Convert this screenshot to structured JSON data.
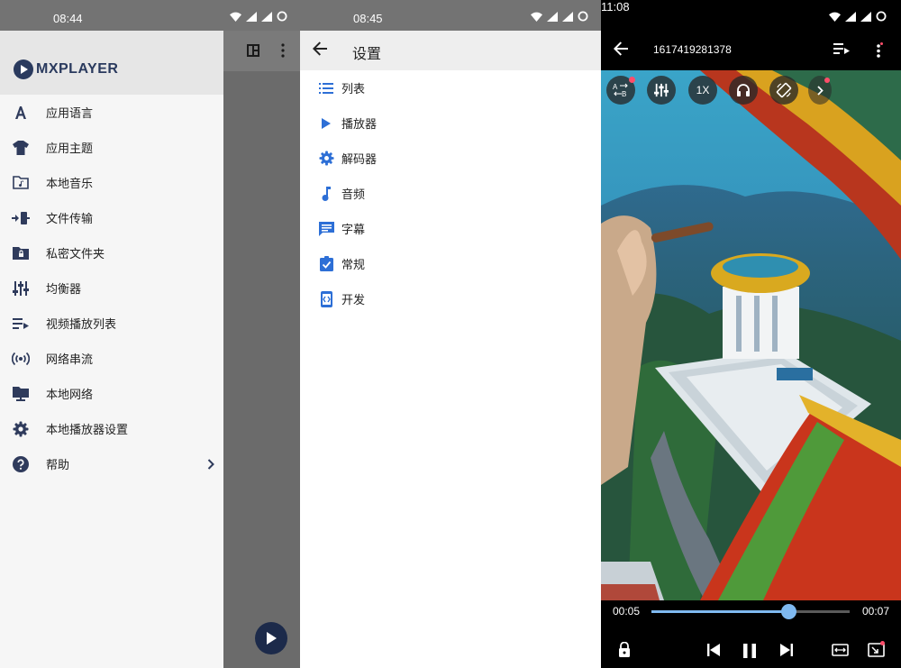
{
  "screen1": {
    "status_time": "08:44",
    "logo": {
      "brand": "MXPLAYER",
      "icon": "mx-play-logo"
    },
    "menu": [
      {
        "label": "应用语言",
        "icon": "language-icon"
      },
      {
        "label": "应用主题",
        "icon": "tshirt-icon"
      },
      {
        "label": "本地音乐",
        "icon": "music-folder-icon"
      },
      {
        "label": "文件传输",
        "icon": "file-transfer-icon"
      },
      {
        "label": "私密文件夹",
        "icon": "lock-folder-icon"
      },
      {
        "label": "均衡器",
        "icon": "equalizer-icon"
      },
      {
        "label": "视频播放列表",
        "icon": "playlist-icon"
      },
      {
        "label": "网络串流",
        "icon": "stream-icon"
      },
      {
        "label": "本地网络",
        "icon": "network-folder-icon"
      },
      {
        "label": "本地播放器设置",
        "icon": "gear-icon"
      },
      {
        "label": "帮助",
        "icon": "help-icon",
        "has_chevron": true
      }
    ]
  },
  "screen2": {
    "status_time": "08:45",
    "title": "设置",
    "items": [
      {
        "label": "列表",
        "icon": "list-icon"
      },
      {
        "label": "播放器",
        "icon": "play-icon"
      },
      {
        "label": "解码器",
        "icon": "gear-icon"
      },
      {
        "label": "音频",
        "icon": "music-note-icon"
      },
      {
        "label": "字幕",
        "icon": "subtitle-icon"
      },
      {
        "label": "常规",
        "icon": "checklist-icon"
      },
      {
        "label": "开发",
        "icon": "developer-icon"
      }
    ]
  },
  "screen3": {
    "status_time": "11:08",
    "video_title": "1617419281378",
    "speed_label": "1X",
    "current_time": "00:05",
    "duration": "00:07",
    "progress": 0.69,
    "colors": {
      "accent": "#7fb9f0",
      "badge": "#ff4d6a"
    }
  }
}
